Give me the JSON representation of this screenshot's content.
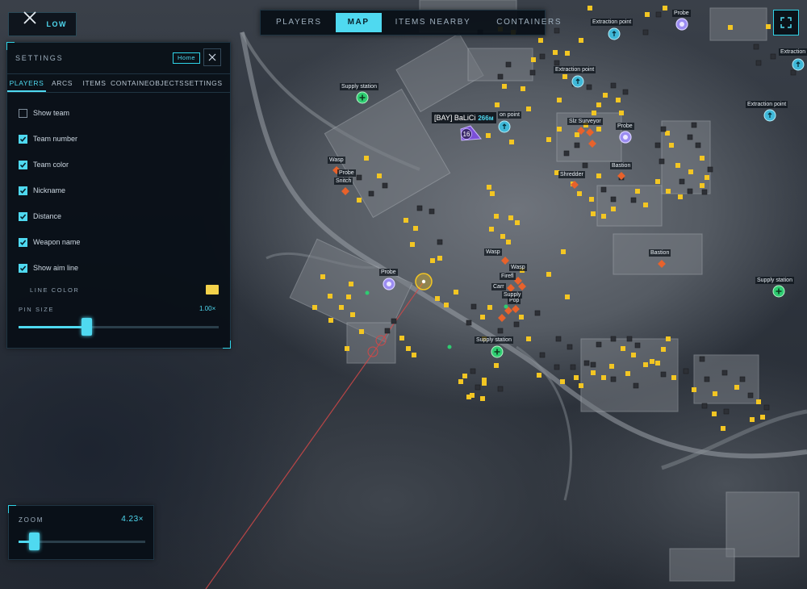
{
  "top_tabs": [
    {
      "label": "PLAYERS",
      "active": false
    },
    {
      "label": "MAP",
      "active": true
    },
    {
      "label": "ITEMS NEARBY",
      "active": false
    },
    {
      "label": "CONTAINERS",
      "active": false
    }
  ],
  "follow_label": "LOW",
  "settings": {
    "title": "SETTINGS",
    "home_label": "Home",
    "tabs": [
      "PLAYERS",
      "ARCS",
      "ITEMS",
      "CONTAINERS",
      "OBJECTS",
      "SETTINGS"
    ],
    "active_tab": "PLAYERS",
    "options": [
      {
        "label": "Show team",
        "checked": false
      },
      {
        "label": "Team number",
        "checked": true
      },
      {
        "label": "Team color",
        "checked": true
      },
      {
        "label": "Nickname",
        "checked": true
      },
      {
        "label": "Distance",
        "checked": true
      },
      {
        "label": "Weapon name",
        "checked": true
      },
      {
        "label": "Show aim line",
        "checked": true
      }
    ],
    "line_color_label": "LINE COLOR",
    "line_color": "#f3d24a",
    "pin_size_label": "PIN SIZE",
    "pin_size_value": "1.00×",
    "pin_size_fraction": 0.34
  },
  "zoom": {
    "label": "ZOOM",
    "value": "4.23×",
    "fraction": 0.12
  },
  "player": {
    "name": "[BAY] BaLiCi",
    "distance": "266м",
    "team_number": "16"
  },
  "map_labels": [
    "Supply station",
    "Extraction point",
    "Extraction point",
    "Extraction point",
    "Extraction point",
    "Supply station",
    "Supply station",
    "Probe",
    "Probe",
    "Probe",
    "Wasp",
    "Probe",
    "Snitch",
    "Slz Surveyor",
    "Shredder",
    "Bastion",
    "Bastion",
    "Wasp",
    "Wasp",
    "Firefl",
    "Carr",
    "Pop",
    "Supply",
    "on point",
    "Supply station"
  ],
  "colors": {
    "accent": "#4fd9f0",
    "loot": "#f3c623",
    "enemy": "#e8622b",
    "probe": "#9b8cf2",
    "supply": "#2ecc71",
    "extraction": "#3fb8d8",
    "aim_line": "#d04848"
  }
}
